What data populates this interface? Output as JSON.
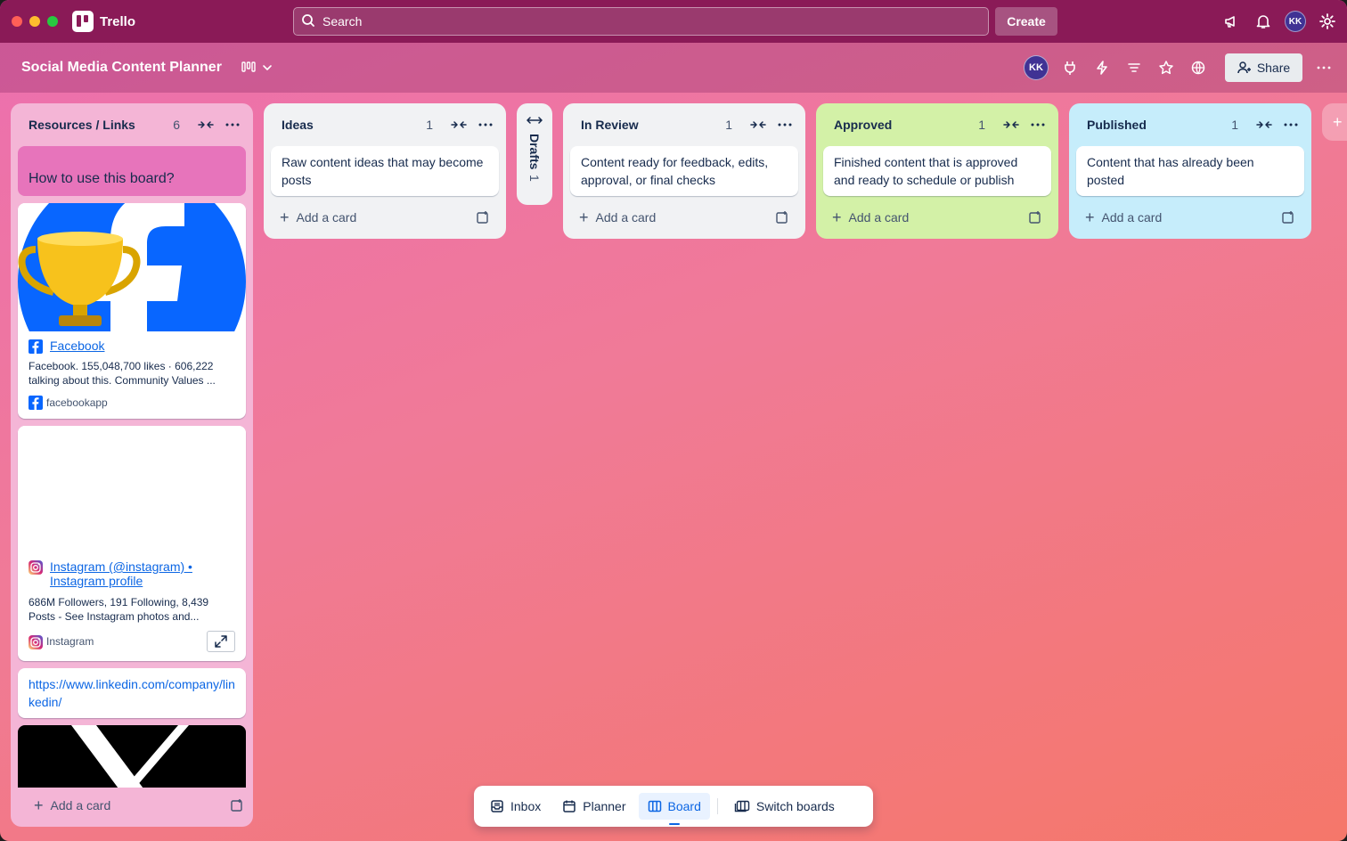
{
  "app": {
    "name": "Trello",
    "search_placeholder": "Search",
    "create_label": "Create",
    "user_initials": "KK"
  },
  "board": {
    "title": "Social Media Content Planner",
    "member_initials": "KK",
    "share_label": "Share"
  },
  "add_card_label": "Add a card",
  "lists": {
    "resources": {
      "title": "Resources / Links",
      "count": "6",
      "color": "#f4b5d6",
      "pinned_card": "How to use this board?",
      "facebook": {
        "title": "Facebook",
        "description": "Facebook. 155,048,700 likes · 606,222 talking about this. Community Values ...",
        "source": "facebookapp"
      },
      "instagram": {
        "title": "Instagram (@instagram) • Instagram profile",
        "description": "686M Followers, 191 Following, 8,439 Posts - See Instagram photos and...",
        "source": "Instagram"
      },
      "linkedin_url": "https://www.linkedin.com/company/linkedin/"
    },
    "ideas": {
      "title": "Ideas",
      "count": "1",
      "card": "Raw content ideas that may become posts"
    },
    "drafts": {
      "title": "Drafts",
      "count": "1"
    },
    "review": {
      "title": "In Review",
      "count": "1",
      "card": "Content ready for feedback, edits, approval, or final checks"
    },
    "approved": {
      "title": "Approved",
      "count": "1",
      "card": "Finished content that is approved and ready to schedule or publish",
      "color": "#d3f1a7"
    },
    "published": {
      "title": "Published",
      "count": "1",
      "card": "Content that has already been posted",
      "color": "#c6edfb"
    }
  },
  "bottom_nav": {
    "inbox": "Inbox",
    "planner": "Planner",
    "board": "Board",
    "switch": "Switch boards",
    "active": "Board"
  },
  "colors": {
    "topbar": "#8a1a57",
    "link": "#0c66e4",
    "facebook_blue": "#0866ff"
  }
}
